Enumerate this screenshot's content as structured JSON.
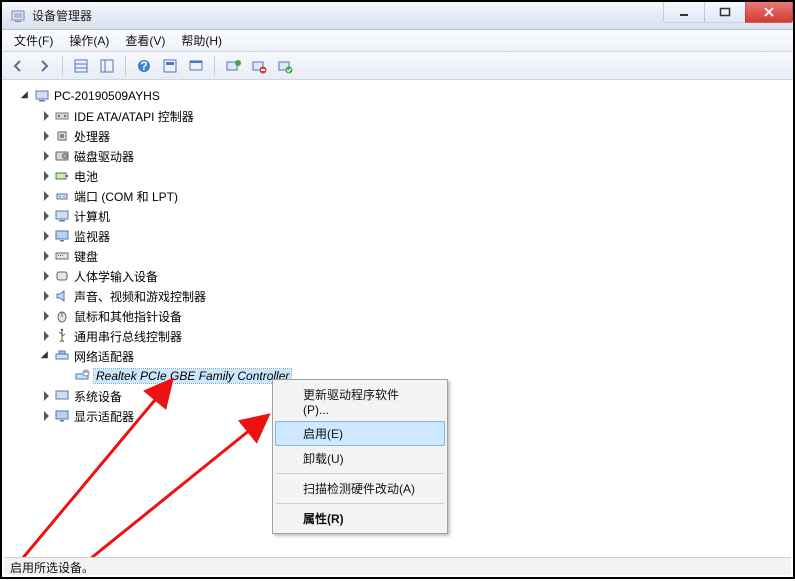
{
  "window": {
    "title": "设备管理器"
  },
  "menu": {
    "file": "文件(F)",
    "action": "操作(A)",
    "view": "查看(V)",
    "help": "帮助(H)"
  },
  "tree": {
    "root": "PC-20190509AYHS",
    "items": [
      {
        "label": "IDE ATA/ATAPI 控制器"
      },
      {
        "label": "处理器"
      },
      {
        "label": "磁盘驱动器"
      },
      {
        "label": "电池"
      },
      {
        "label": "端口 (COM 和 LPT)"
      },
      {
        "label": "计算机"
      },
      {
        "label": "监视器"
      },
      {
        "label": "键盘"
      },
      {
        "label": "人体学输入设备"
      },
      {
        "label": "声音、视频和游戏控制器"
      },
      {
        "label": "鼠标和其他指针设备"
      },
      {
        "label": "通用串行总线控制器"
      },
      {
        "label": "网络适配器",
        "expanded": true,
        "children": [
          {
            "label": "Realtek PCIe GBE Family Controller",
            "selected": true
          }
        ]
      },
      {
        "label": "系统设备"
      },
      {
        "label": "显示适配器"
      }
    ]
  },
  "context_menu": {
    "update_driver": "更新驱动程序软件(P)...",
    "enable": "启用(E)",
    "uninstall": "卸载(U)",
    "scan": "扫描检测硬件改动(A)",
    "properties": "属性(R)"
  },
  "statusbar": {
    "text": "启用所选设备。"
  }
}
